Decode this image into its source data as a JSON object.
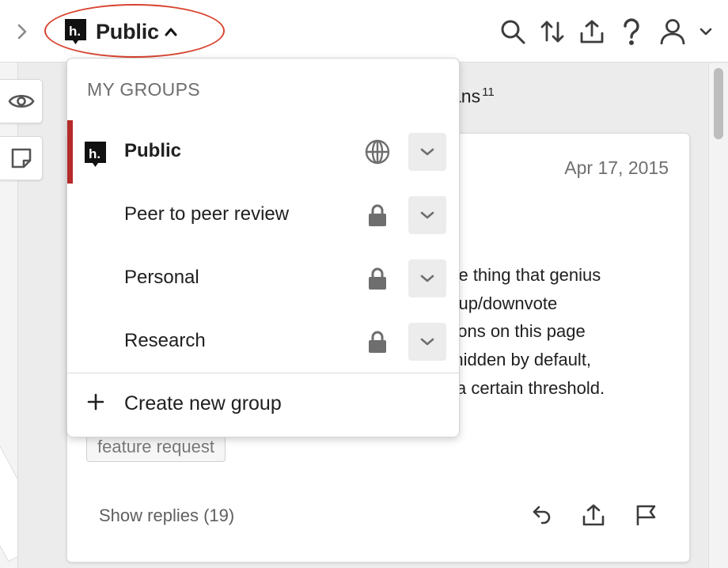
{
  "topbar": {
    "group_name": "Public"
  },
  "stream": {
    "header_text": "ans",
    "header_count": "11"
  },
  "annotation": {
    "date": "Apr 17, 2015",
    "body_lines": [
      "one thing that genius",
      "to up/downvote",
      "ations on this page",
      "e hidden by default,",
      "w a certain threshold."
    ],
    "tag": "feature request",
    "show_replies": "Show replies (19)"
  },
  "group_menu": {
    "heading": "MY GROUPS",
    "items": [
      {
        "name": "Public",
        "type_icon": "globe-icon",
        "active": true
      },
      {
        "name": "Peer to peer review",
        "type_icon": "lock-icon",
        "active": false
      },
      {
        "name": "Personal",
        "type_icon": "lock-icon",
        "active": false
      },
      {
        "name": "Research",
        "type_icon": "lock-icon",
        "active": false
      }
    ],
    "create_label": "Create new group"
  },
  "colors": {
    "active_bar": "#b52a2a",
    "highlight_ring": "#d9432f",
    "icon_dark": "#3c3c3c",
    "icon_grey": "#6e6e6e"
  }
}
